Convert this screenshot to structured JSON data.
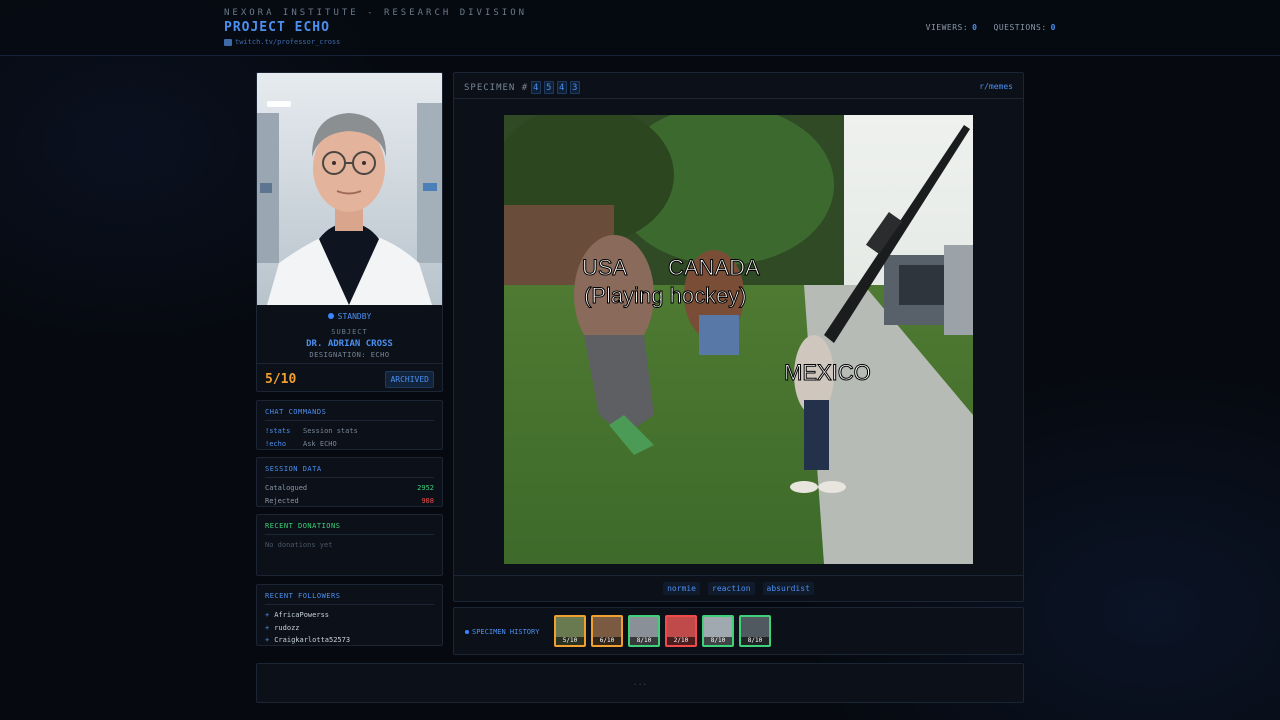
{
  "header": {
    "org": "NEXORA INSTITUTE - RESEARCH DIVISION",
    "project": "PROJECT ECHO",
    "channel": "twitch.tv/professor_cross",
    "viewers_label": "VIEWERS:",
    "viewers": "0",
    "questions_label": "QUESTIONS:",
    "questions": "0"
  },
  "profile": {
    "status": "STANDBY",
    "subject_label": "SUBJECT",
    "name": "DR. ADRIAN CROSS",
    "designation": "DESIGNATION: ECHO",
    "score": "5/10",
    "archived_label": "ARCHIVED"
  },
  "chat_commands": {
    "title": "CHAT COMMANDS",
    "items": [
      {
        "cmd": "!stats",
        "desc": "Session stats"
      },
      {
        "cmd": "!echo",
        "desc": "Ask ECHO"
      }
    ]
  },
  "session": {
    "title": "SESSION DATA",
    "catalogued_label": "Catalogued",
    "catalogued": "2952",
    "rejected_label": "Rejected",
    "rejected": "908"
  },
  "donations": {
    "title": "RECENT DONATIONS",
    "empty": "No donations yet"
  },
  "followers": {
    "title": "RECENT FOLLOWERS",
    "items": [
      "AfricaPowerss",
      "rudozz",
      "Craigkarlotta52573"
    ]
  },
  "specimen": {
    "label": "SPECIMEN #",
    "digits": [
      "4",
      "5",
      "4",
      "3"
    ],
    "source": "r/memes",
    "meme_text": {
      "usa": "USA",
      "canada": "CANADA",
      "sub": "(Playing hockey)",
      "mexico": "MEXICO"
    },
    "tags": [
      "normie",
      "reaction",
      "absurdist"
    ]
  },
  "history": {
    "label": "SPECIMEN HISTORY",
    "items": [
      {
        "score": "5/10",
        "color": "#f0a030"
      },
      {
        "score": "6/10",
        "color": "#f0a030"
      },
      {
        "score": "8/10",
        "color": "#3fd17a"
      },
      {
        "score": "2/10",
        "color": "#f04a4a"
      },
      {
        "score": "8/10",
        "color": "#3fd17a"
      },
      {
        "score": "8/10",
        "color": "#3fd17a"
      }
    ]
  },
  "footer": {
    "placeholder": "..."
  },
  "colors": {
    "accent": "#4b8ff0",
    "good": "#3fd17a",
    "bad": "#f04a4a",
    "warn": "#f0a030"
  }
}
